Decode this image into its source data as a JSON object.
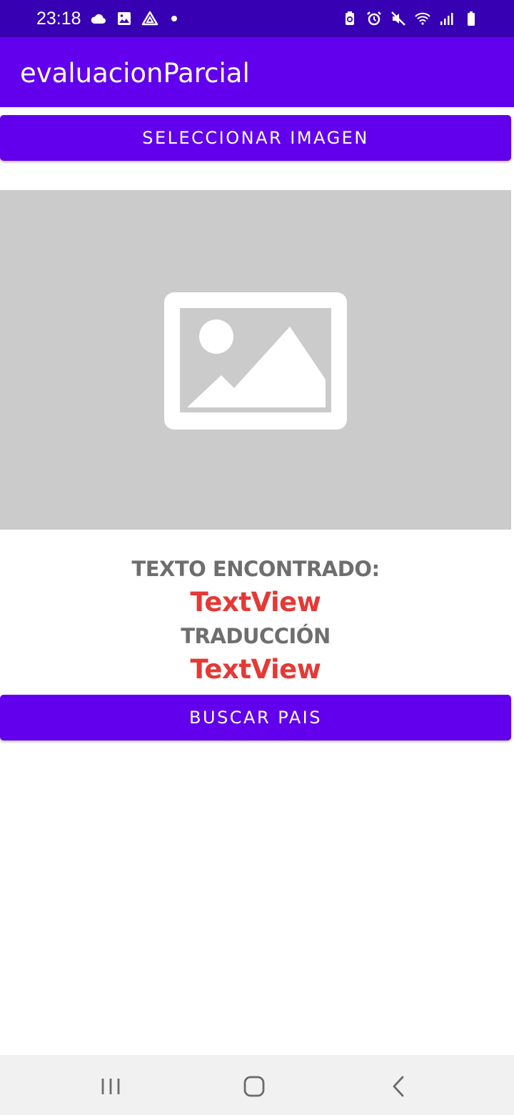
{
  "status_bar": {
    "time": "23:18",
    "left_icons": [
      "cloud-icon",
      "gallery-icon",
      "drive-icon",
      "notification-dot"
    ],
    "right_icons": [
      "battery-saver-icon",
      "alarm-icon",
      "mute-icon",
      "wifi-icon",
      "signal-icon",
      "battery-icon"
    ],
    "background": "#3700b3"
  },
  "app_bar": {
    "title": "evaluacionParcial",
    "background": "#6200ee"
  },
  "main": {
    "select_image_button": "SELECCIONAR IMAGEN",
    "image_placeholder_icon": "image-placeholder-icon",
    "found_text_label": "TEXTO ENCONTRADO:",
    "found_text_value": "TextView",
    "translation_label": "TRADUCCIÓN",
    "translation_value": "TextView",
    "search_country_button": "BUSCAR PAIS",
    "accent_color": "#6200ee",
    "value_color": "#e53935"
  },
  "nav_bar": {
    "buttons": [
      "recents-icon",
      "home-icon",
      "back-icon"
    ]
  }
}
